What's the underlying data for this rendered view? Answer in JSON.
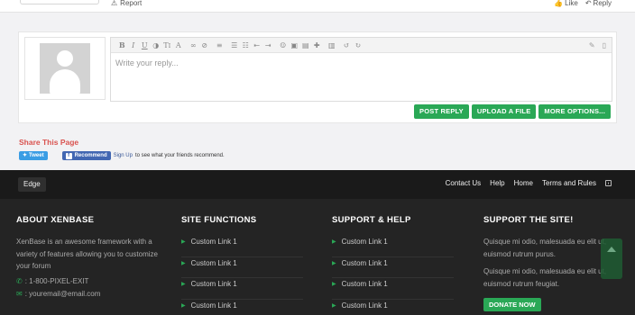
{
  "post": {
    "report_label": "Report",
    "like_label": "Like",
    "reply_label": "Reply"
  },
  "editor": {
    "placeholder": "Write your reply...",
    "toolbar_icons": [
      "bold-icon",
      "italic-icon",
      "underline-icon",
      "color-icon",
      "text-size-icon",
      "font-icon",
      "link-icon",
      "unlink-icon",
      "align-icon",
      "bullet-list-icon",
      "numbered-list-icon",
      "outdent-icon",
      "indent-icon",
      "smilie-icon",
      "image-icon",
      "media-icon",
      "insert-icon",
      "code-icon",
      "undo-icon",
      "redo-icon",
      "eraser-icon",
      "source-icon"
    ]
  },
  "buttons": {
    "post_reply": "POST REPLY",
    "upload_file": "UPLOAD A FILE",
    "more_options": "MORE OPTIONS..."
  },
  "share": {
    "title": "Share This Page",
    "tweet": "Tweet",
    "recommend": "Recommend",
    "signup_link": "Sign Up",
    "signup_text": "to see what your friends recommend."
  },
  "footer_bar": {
    "style": "Edge",
    "links": [
      "Contact Us",
      "Help",
      "Home",
      "Terms and Rules"
    ]
  },
  "footer": {
    "about": {
      "title": "ABOUT XENBASE",
      "text": "XenBase is an awesome framework with a variety of features allowing you to customize your forum",
      "phone": ": 1-800-PIXEL-EXIT",
      "email": ": youremail@email.com"
    },
    "functions": {
      "title": "SITE FUNCTIONS",
      "links": [
        "Custom Link 1",
        "Custom Link 1",
        "Custom Link 1",
        "Custom Link 1"
      ]
    },
    "support": {
      "title": "SUPPORT & HELP",
      "links": [
        "Custom Link 1",
        "Custom Link 1",
        "Custom Link 1",
        "Custom Link 1"
      ]
    },
    "donate": {
      "title": "SUPPORT THE SITE!",
      "text1": "Quisque mi odio, malesuada eu elit ut, euismod rutrum purus.",
      "text2": "Quisque mi odio, malesuada eu elit ut, euismod rutrum feugiat.",
      "button": "DONATE NOW"
    }
  },
  "colors": {
    "accent": "#2aa856",
    "share_title": "#d9534f",
    "footer_bg": "#242424"
  }
}
